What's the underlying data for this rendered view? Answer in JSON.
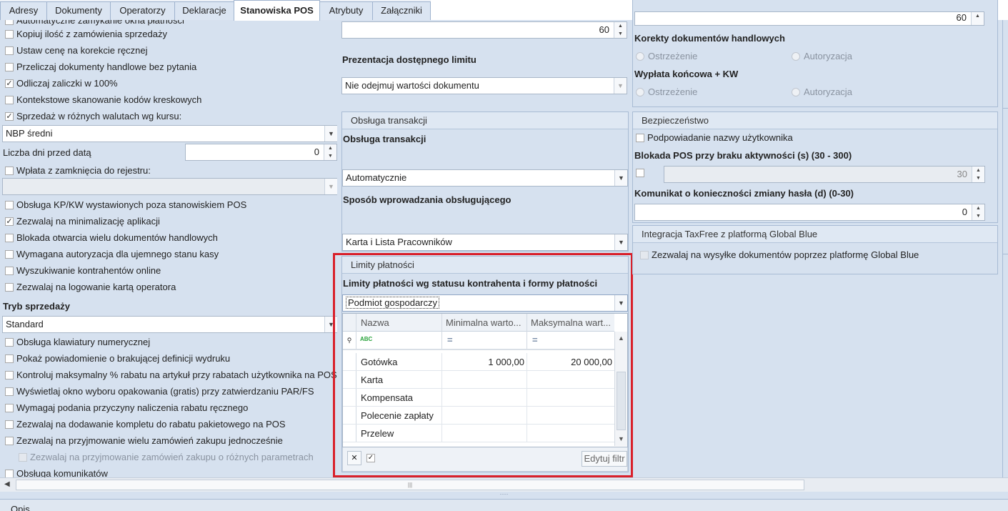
{
  "tabs": [
    "Adresy",
    "Dokumenty",
    "Operatorzy",
    "Deklaracje",
    "Stanowiska POS",
    "Atrybuty",
    "Załączniki"
  ],
  "left": {
    "cut_top_label": "Automatyczne zamykanie okna płatności",
    "options_a": [
      {
        "label": "Kopiuj ilość z zamówienia sprzedaży",
        "checked": false
      },
      {
        "label": "Ustaw cenę na korekcie ręcznej",
        "checked": false
      },
      {
        "label": "Przeliczaj dokumenty handlowe bez pytania",
        "checked": false
      },
      {
        "label": "Odliczaj zaliczki w 100%",
        "checked": true
      },
      {
        "label": "Kontekstowe skanowanie kodów kreskowych",
        "checked": false
      },
      {
        "label": "Sprzedaż w różnych walutach wg kursu:",
        "checked": true
      }
    ],
    "currency_rate_value": "NBP średni",
    "days_before_label": "Liczba dni przed datą",
    "days_before_value": "0",
    "closing_payment_label": "Wpłata z zamknięcia do rejestru:",
    "closing_payment_checked": false,
    "closing_payment_value": "",
    "options_b": [
      {
        "label": "Obsługa KP/KW wystawionych poza stanowiskiem POS",
        "checked": false
      },
      {
        "label": "Zezwalaj na minimalizację aplikacji",
        "checked": true
      },
      {
        "label": "Blokada otwarcia wielu dokumentów handlowych",
        "checked": false
      },
      {
        "label": "Wymagana autoryzacja dla ujemnego stanu kasy",
        "checked": false
      },
      {
        "label": "Wyszukiwanie kontrahentów online",
        "checked": false
      },
      {
        "label": "Zezwalaj na logowanie kartą operatora",
        "checked": false
      }
    ],
    "sales_mode_label": "Tryb sprzedaży",
    "sales_mode_value": "Standard",
    "options_c": [
      {
        "label": "Obsługa klawiatury numerycznej",
        "checked": false
      },
      {
        "label": "Pokaż powiadomienie o brakującej definicji wydruku",
        "checked": false
      },
      {
        "label": "Kontroluj maksymalny % rabatu na artykuł przy rabatach użytkownika na POS",
        "checked": false
      },
      {
        "label": "Wyświetlaj okno wyboru opakowania (gratis) przy zatwierdzaniu PAR/FS",
        "checked": false
      },
      {
        "label": "Wymagaj podania przyczyny naliczenia rabatu ręcznego",
        "checked": false
      },
      {
        "label": "Zezwalaj na dodawanie kompletu do rabatu pakietowego na POS",
        "checked": false
      },
      {
        "label": "Zezwalaj na przyjmowanie wielu zamówień zakupu jednocześnie",
        "checked": false
      }
    ],
    "sub_option_label": "Zezwalaj na przyjmowanie zamówień zakupu o różnych parametrach",
    "last_option_label": "Obsługa komunikatów"
  },
  "middle": {
    "top_number": "60",
    "limit_presentation_label": "Prezentacja dostępnego limitu",
    "limit_presentation_value": "Nie odejmuj wartości dokumentu",
    "transactions_group_title": "Obsługa transakcji",
    "transactions_label": "Obsługa transakcji",
    "transactions_value": "Automatycznie",
    "input_method_label": "Sposób wprowadzania obsługującego",
    "input_method_value": "Karta i Lista Pracowników",
    "limits_group_title": "Limity płatności",
    "limits_label": "Limity płatności wg statusu kontrahenta i formy płatności",
    "limits_status_value": "Podmiot gospodarczy",
    "grid": {
      "columns": [
        "Nazwa",
        "Minimalna warto...",
        "Maksymalna wart..."
      ],
      "filter_symbol": "=",
      "rows": [
        {
          "name": "Gotówka",
          "min": "1 000,00",
          "max": "20 000,00"
        },
        {
          "name": "Karta",
          "min": "",
          "max": ""
        },
        {
          "name": "Kompensata",
          "min": "",
          "max": ""
        },
        {
          "name": "Polecenie zapłaty",
          "min": "",
          "max": ""
        },
        {
          "name": "Przelew",
          "min": "",
          "max": ""
        }
      ],
      "edit_filter_label": "Edytuj filtr"
    }
  },
  "right": {
    "top_number": "60",
    "corrections_label": "Korekty dokumentów handlowych",
    "final_payment_label": "Wypłata końcowa + KW",
    "radio_warning": "Ostrzeżenie",
    "radio_authorization": "Autoryzacja",
    "security_group_title": "Bezpieczeństwo",
    "suggest_username_label": "Podpowiadanie nazwy użytkownika",
    "pos_lock_label": "Blokada POS przy braku aktywności (s) (30 - 300)",
    "pos_lock_value": "30",
    "password_change_label": "Komunikat o konieczności zmiany hasła (d) (0-30)",
    "password_change_value": "0",
    "taxfree_group_title": "Integracja TaxFree z platformą Global Blue",
    "taxfree_option_label": "Zezwalaj na wysyłke dokumentów poprzez platformę Global Blue"
  },
  "bottom": {
    "section_label": "Opis"
  },
  "colors": {
    "highlight_border": "#d9202a",
    "background": "#d6e1ef",
    "tab_active": "#ffffff"
  }
}
